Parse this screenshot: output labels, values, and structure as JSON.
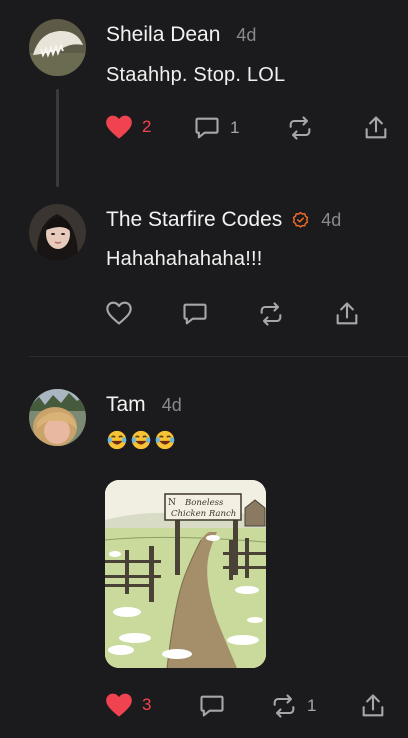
{
  "posts": [
    {
      "author": "Sheila Dean",
      "time": "4d",
      "text": "Staahhp. Stop. LOL",
      "likes": "2",
      "replies": "1",
      "reposts": "",
      "liked": true,
      "avatar_icon": "sheila-avatar"
    },
    {
      "author": "The Starfire Codes",
      "time": "4d",
      "text": "Hahahahahaha!!!",
      "verified_icon": "check-badge-icon",
      "likes": "",
      "replies": "",
      "reposts": "",
      "liked": false
    },
    {
      "author": "Tam",
      "time": "4d",
      "text_emoji": [
        "😂",
        "😂",
        "😂"
      ],
      "image_sign": [
        "Boneless",
        "Chicken Ranch"
      ],
      "likes": "3",
      "replies": "",
      "reposts": "1",
      "liked": true
    }
  ],
  "colors": {
    "background": "#1b1b1d",
    "like_active": "#ef4450",
    "verified": "#f26b2a",
    "muted": "#8a8a8e"
  }
}
